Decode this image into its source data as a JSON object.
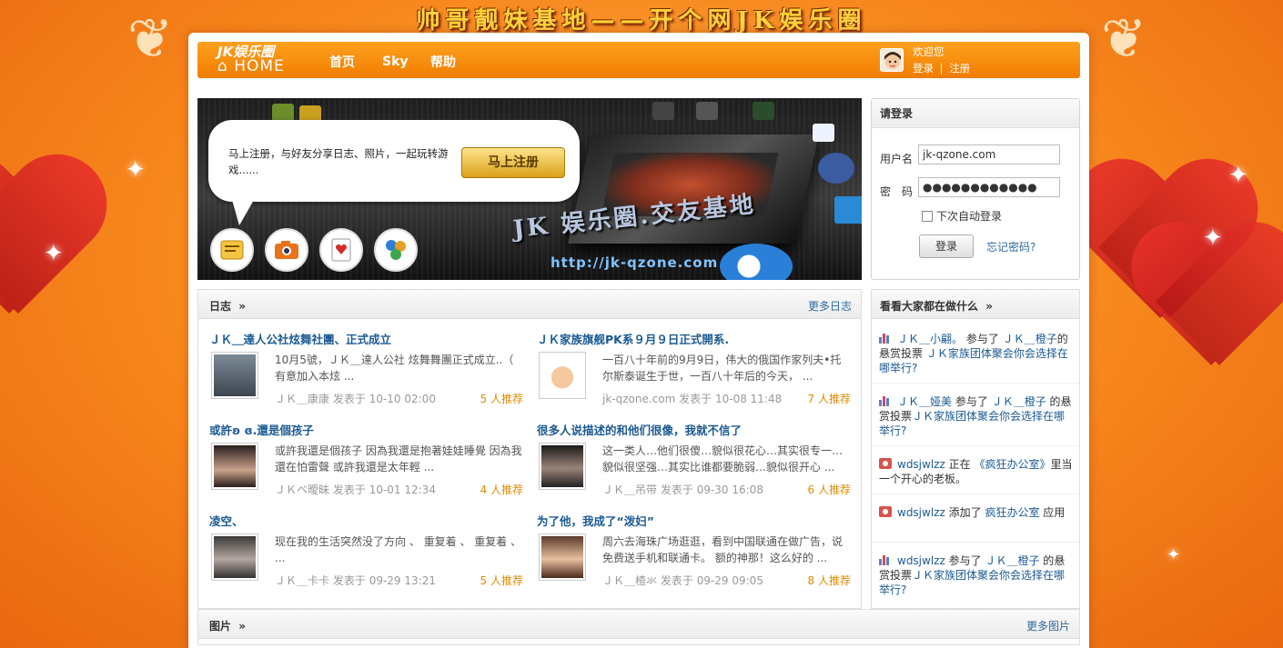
{
  "banner_title": "帅哥靓妹基地——开个网JK娱乐圈",
  "nav": {
    "logo_line1": "JK娱乐圈",
    "logo_line2": "HOME",
    "items": [
      {
        "label": "首页"
      },
      {
        "label": "Sky"
      },
      {
        "label": "帮助"
      }
    ],
    "welcome": "欢迎您",
    "login_link": "登录",
    "separator": "|",
    "register_link": "注册"
  },
  "promo": {
    "bubble_text": "马上注册，与好友分享日志、照片，一起玩转游戏......",
    "register_button": "马上注册",
    "caption": "JK 娱乐圈.交友基地",
    "url": "http://jk-qzone.com"
  },
  "login": {
    "title": "请登录",
    "username_label": "用户名",
    "username_value": "jk-qzone.com",
    "password_label": "密　码",
    "password_value": "●●●●●●●●●●●●",
    "remember_label": "下次自动登录",
    "submit": "登录",
    "forgot": "忘记密码?"
  },
  "blog": {
    "title": "日志",
    "arrow": "»",
    "more": "更多日志",
    "posts": [
      {
        "title": "ＪＫ＿達人公社炫舞社團、正式成立",
        "body": "10月5號，ＪＫ＿達人公社 炫舞舞團正式成立..（ 有意加入本炫 ...",
        "author": "ＪＫ＿康康",
        "posted": "发表于",
        "time": "10-10 02:00",
        "rec": "5 人推荐"
      },
      {
        "title": "ＪＫ家族旗舰PK系９月９日正式開系.",
        "body": "一百八十年前的9月9日，伟大的俄国作家列夫•托尔斯泰诞生于世，一百八十年后的今天， ...",
        "author": "jk-qzone.com",
        "posted": "发表于",
        "time": "10-08 11:48",
        "rec": "7 人推荐"
      },
      {
        "title": "或許ʚ ɞ.還是個孩子",
        "body": "或許我還是個孩子 因為我還是抱著娃娃睡覺 因為我還在怕雷聲 或許我還是太年輕 ...",
        "author": "ＪＫベ曖昧",
        "posted": "发表于",
        "time": "10-01 12:34",
        "rec": "4 人推荐"
      },
      {
        "title": "很多人说描述的和他们很像，我就不信了",
        "body": "这一类人…他们很傻…貌似很花心…其实很专一…貌似很坚强…其实比谁都要脆弱…貌似很开心 ...",
        "author": "ＪＫ＿吊带",
        "posted": "发表于",
        "time": "09-30 16:08",
        "rec": "6 人推荐"
      },
      {
        "title": "凌空、",
        "body": "现在我的生活突然没了方向 、 重复着 、 重复着 、 ...",
        "author": "ＪＫ＿卡卡",
        "posted": "发表于",
        "time": "09-29 13:21",
        "rec": "5 人推荐"
      },
      {
        "title": "为了他，我成了“泼妇”",
        "body": "周六去海珠广场逛逛，看到中国联通在做广告，说免费送手机和联通卡。 额的神那！这么好的 ...",
        "author": "ＪＫ＿楂氺",
        "posted": "发表于",
        "time": "09-29 09:05",
        "rec": "8 人推荐"
      }
    ]
  },
  "activity": {
    "title": "看看大家都在做什么",
    "arrow": "»",
    "items": [
      {
        "icon": "poll-icon",
        "user": "ＪＫ＿小翩。",
        "verb": "参与了",
        "target": "ＪＫ＿橙子",
        "rest": "的悬赏投票",
        "object": "ＪＫ家族团体聚会你会选择在哪举行?"
      },
      {
        "icon": "poll-icon",
        "user": "ＪＫ＿娅美",
        "verb": "参与了",
        "target": "ＪＫ＿橙子",
        "rest": "的悬赏投票",
        "object": "ＪＫ家族团体聚会你会选择在哪举行?"
      },
      {
        "icon": "app-icon",
        "user": "wdsjwlzz",
        "verb": "正在",
        "target": "《疯狂办公室》",
        "rest": "里当一个开心的老板。",
        "object": ""
      },
      {
        "icon": "app-icon",
        "user": "wdsjwlzz",
        "verb": "添加了",
        "target": "疯狂办公室",
        "rest": "应用",
        "object": ""
      },
      {
        "icon": "poll-icon",
        "user": "wdsjwlzz",
        "verb": "参与了",
        "target": "ＪＫ＿橙子",
        "rest": "的悬赏投票",
        "object": "ＪＫ家族团体聚会你会选择在哪举行?"
      }
    ]
  },
  "photos": {
    "title": "图片",
    "arrow": "»",
    "more": "更多图片"
  }
}
